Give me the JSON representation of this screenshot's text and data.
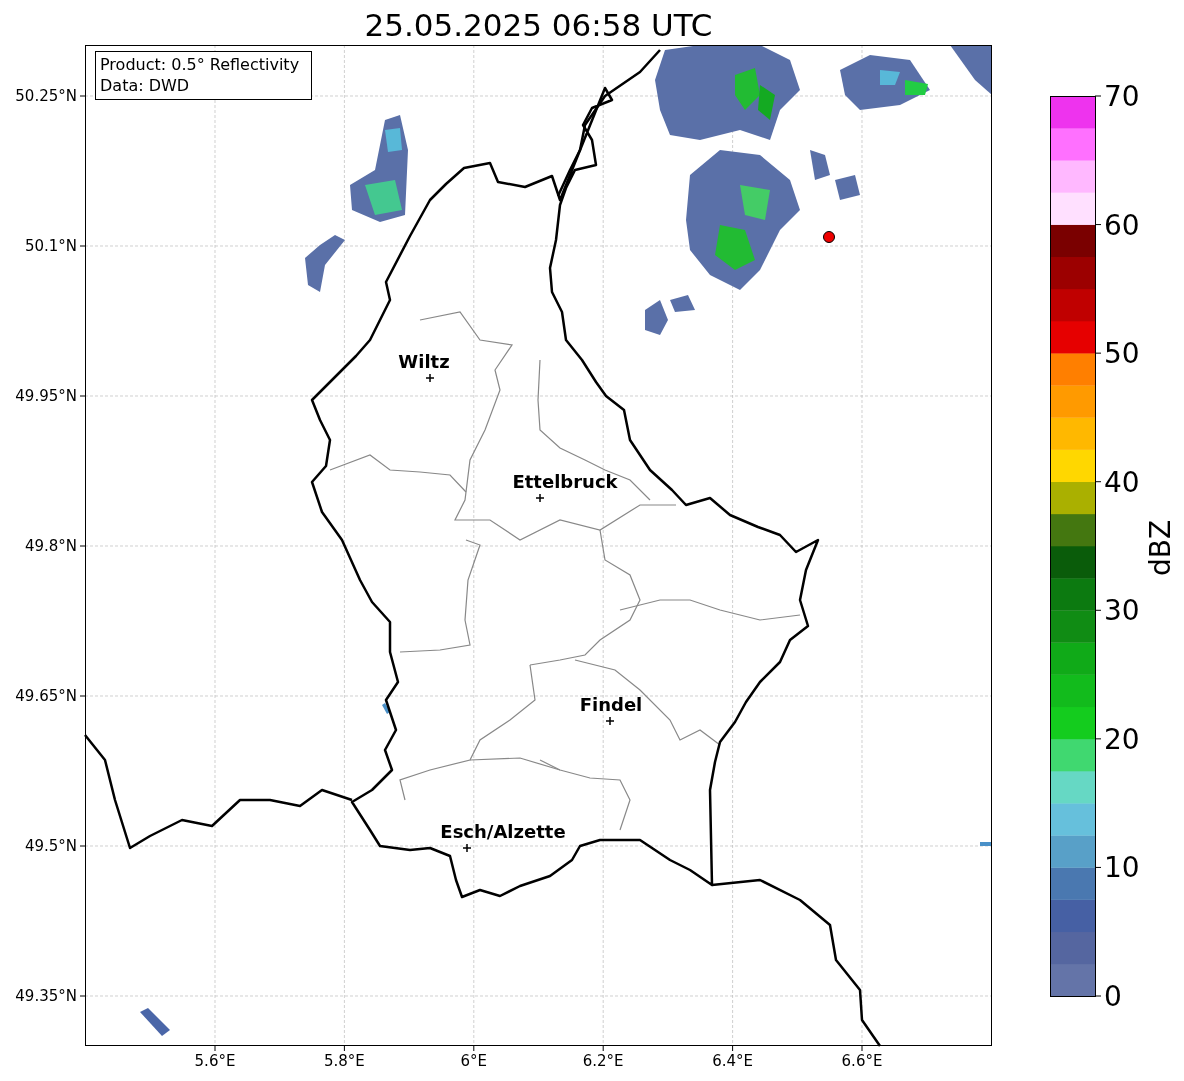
{
  "title": "25.05.2025 06:58 UTC",
  "legend": {
    "lines": [
      "Product: 0.5° Reflectivity",
      "Data: DWD"
    ]
  },
  "map": {
    "latitude_labels": [
      "50.25°N",
      "50.1°N",
      "49.95°N",
      "49.8°N",
      "49.65°N",
      "49.5°N",
      "49.35°N"
    ],
    "longitude_labels": [
      "5.6°E",
      "5.8°E",
      "6°E",
      "6.2°E",
      "6.4°E",
      "6.6°E"
    ],
    "cities": [
      {
        "name": "Wiltz"
      },
      {
        "name": "Ettelbruck"
      },
      {
        "name": "Findel"
      },
      {
        "name": "Esch/Alzette"
      }
    ]
  },
  "colorbar": {
    "label": "dBZ",
    "ticks": [
      "70",
      "60",
      "50",
      "40",
      "30",
      "20",
      "10",
      "0"
    ]
  }
}
